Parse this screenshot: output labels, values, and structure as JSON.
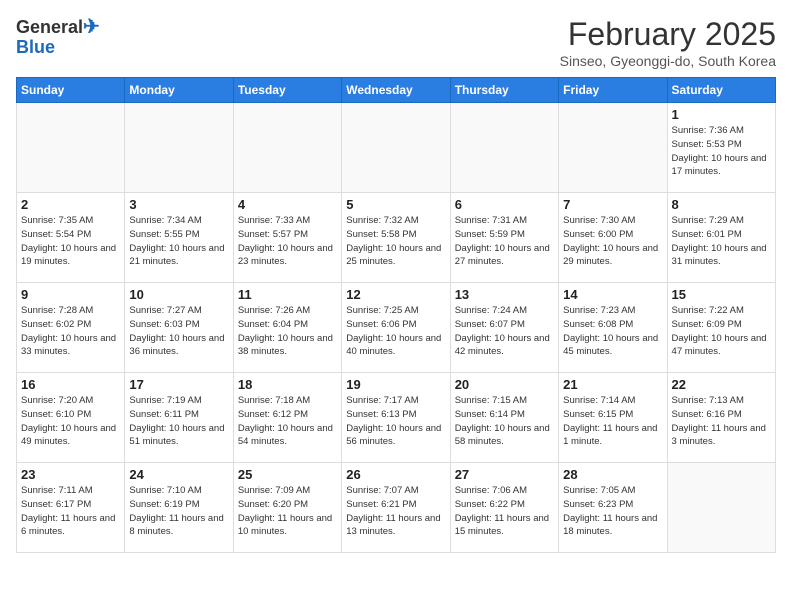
{
  "header": {
    "logo_line1": "General",
    "logo_line2": "Blue",
    "month_title": "February 2025",
    "subtitle": "Sinseo, Gyeonggi-do, South Korea"
  },
  "weekdays": [
    "Sunday",
    "Monday",
    "Tuesday",
    "Wednesday",
    "Thursday",
    "Friday",
    "Saturday"
  ],
  "weeks": [
    [
      null,
      null,
      null,
      null,
      null,
      null,
      {
        "day": 1,
        "sunrise": "7:36 AM",
        "sunset": "5:53 PM",
        "daylight": "10 hours and 17 minutes."
      }
    ],
    [
      {
        "day": 2,
        "sunrise": "7:35 AM",
        "sunset": "5:54 PM",
        "daylight": "10 hours and 19 minutes."
      },
      {
        "day": 3,
        "sunrise": "7:34 AM",
        "sunset": "5:55 PM",
        "daylight": "10 hours and 21 minutes."
      },
      {
        "day": 4,
        "sunrise": "7:33 AM",
        "sunset": "5:57 PM",
        "daylight": "10 hours and 23 minutes."
      },
      {
        "day": 5,
        "sunrise": "7:32 AM",
        "sunset": "5:58 PM",
        "daylight": "10 hours and 25 minutes."
      },
      {
        "day": 6,
        "sunrise": "7:31 AM",
        "sunset": "5:59 PM",
        "daylight": "10 hours and 27 minutes."
      },
      {
        "day": 7,
        "sunrise": "7:30 AM",
        "sunset": "6:00 PM",
        "daylight": "10 hours and 29 minutes."
      },
      {
        "day": 8,
        "sunrise": "7:29 AM",
        "sunset": "6:01 PM",
        "daylight": "10 hours and 31 minutes."
      }
    ],
    [
      {
        "day": 9,
        "sunrise": "7:28 AM",
        "sunset": "6:02 PM",
        "daylight": "10 hours and 33 minutes."
      },
      {
        "day": 10,
        "sunrise": "7:27 AM",
        "sunset": "6:03 PM",
        "daylight": "10 hours and 36 minutes."
      },
      {
        "day": 11,
        "sunrise": "7:26 AM",
        "sunset": "6:04 PM",
        "daylight": "10 hours and 38 minutes."
      },
      {
        "day": 12,
        "sunrise": "7:25 AM",
        "sunset": "6:06 PM",
        "daylight": "10 hours and 40 minutes."
      },
      {
        "day": 13,
        "sunrise": "7:24 AM",
        "sunset": "6:07 PM",
        "daylight": "10 hours and 42 minutes."
      },
      {
        "day": 14,
        "sunrise": "7:23 AM",
        "sunset": "6:08 PM",
        "daylight": "10 hours and 45 minutes."
      },
      {
        "day": 15,
        "sunrise": "7:22 AM",
        "sunset": "6:09 PM",
        "daylight": "10 hours and 47 minutes."
      }
    ],
    [
      {
        "day": 16,
        "sunrise": "7:20 AM",
        "sunset": "6:10 PM",
        "daylight": "10 hours and 49 minutes."
      },
      {
        "day": 17,
        "sunrise": "7:19 AM",
        "sunset": "6:11 PM",
        "daylight": "10 hours and 51 minutes."
      },
      {
        "day": 18,
        "sunrise": "7:18 AM",
        "sunset": "6:12 PM",
        "daylight": "10 hours and 54 minutes."
      },
      {
        "day": 19,
        "sunrise": "7:17 AM",
        "sunset": "6:13 PM",
        "daylight": "10 hours and 56 minutes."
      },
      {
        "day": 20,
        "sunrise": "7:15 AM",
        "sunset": "6:14 PM",
        "daylight": "10 hours and 58 minutes."
      },
      {
        "day": 21,
        "sunrise": "7:14 AM",
        "sunset": "6:15 PM",
        "daylight": "11 hours and 1 minute."
      },
      {
        "day": 22,
        "sunrise": "7:13 AM",
        "sunset": "6:16 PM",
        "daylight": "11 hours and 3 minutes."
      }
    ],
    [
      {
        "day": 23,
        "sunrise": "7:11 AM",
        "sunset": "6:17 PM",
        "daylight": "11 hours and 6 minutes."
      },
      {
        "day": 24,
        "sunrise": "7:10 AM",
        "sunset": "6:19 PM",
        "daylight": "11 hours and 8 minutes."
      },
      {
        "day": 25,
        "sunrise": "7:09 AM",
        "sunset": "6:20 PM",
        "daylight": "11 hours and 10 minutes."
      },
      {
        "day": 26,
        "sunrise": "7:07 AM",
        "sunset": "6:21 PM",
        "daylight": "11 hours and 13 minutes."
      },
      {
        "day": 27,
        "sunrise": "7:06 AM",
        "sunset": "6:22 PM",
        "daylight": "11 hours and 15 minutes."
      },
      {
        "day": 28,
        "sunrise": "7:05 AM",
        "sunset": "6:23 PM",
        "daylight": "11 hours and 18 minutes."
      },
      null
    ]
  ]
}
